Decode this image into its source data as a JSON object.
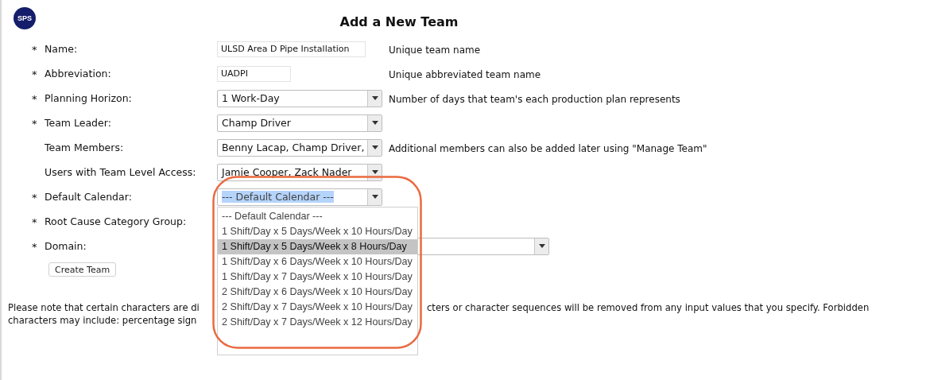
{
  "logo": "SPS",
  "title": "Add a New Team",
  "fields": [
    {
      "kind": "text",
      "marker": "*",
      "label": "Name:",
      "value": "ULSD Area D Pipe Installation",
      "hint": "Unique team name"
    },
    {
      "kind": "short-text",
      "marker": "*",
      "label": "Abbreviation:",
      "value": "UADPI",
      "hint": "Unique abbreviated team name"
    },
    {
      "kind": "select",
      "marker": "*",
      "label": "Planning Horizon:",
      "value": "1 Work-Day",
      "hint": "Number of days that team's each production plan represents"
    },
    {
      "kind": "select",
      "marker": "*",
      "label": "Team Leader:",
      "value": "Champ Driver"
    },
    {
      "kind": "select",
      "label": "Team Members:",
      "value": "Benny Lacap, Champ Driver,",
      "hint": "Additional members can also be added later using \"Manage Team\""
    },
    {
      "kind": "select",
      "label": "Users with Team Level Access:",
      "value": "Jamie Cooper, Zack Nader"
    },
    {
      "kind": "open-select",
      "marker": "*",
      "label": "Default Calendar:",
      "value": "--- Default Calendar ---",
      "text_highlighted": true
    },
    {
      "kind": "hidden",
      "marker": "*",
      "label": "Root Cause Category Group:"
    },
    {
      "kind": "wide-select",
      "marker": "*",
      "label": "Domain:"
    }
  ],
  "calendar_options": [
    {
      "label": "--- Default Calendar ---",
      "selected": false
    },
    {
      "label": "1 Shift/Day x 5 Days/Week x 10 Hours/Day",
      "selected": false
    },
    {
      "label": "1 Shift/Day x 5 Days/Week x 8 Hours/Day",
      "selected": true
    },
    {
      "label": "1 Shift/Day x 6 Days/Week x 10 Hours/Day",
      "selected": false
    },
    {
      "label": "1 Shift/Day x 7 Days/Week x 10 Hours/Day",
      "selected": false
    },
    {
      "label": "2 Shift/Day x 6 Days/Week x 10 Hours/Day",
      "selected": false
    },
    {
      "label": "2 Shift/Day x 7 Days/Week x 10 Hours/Day",
      "selected": false
    },
    {
      "label": "2 Shift/Day x 7 Days/Week x 12 Hours/Day",
      "selected": false
    }
  ],
  "create_button": "Create Team",
  "note_lines": [
    {
      "start": "Please note that certain characters are di",
      "end": "cters or character sequences will be removed from any input values that you specify. Forbidden"
    },
    {
      "start": "characters may include: percentage sign"
    }
  ]
}
